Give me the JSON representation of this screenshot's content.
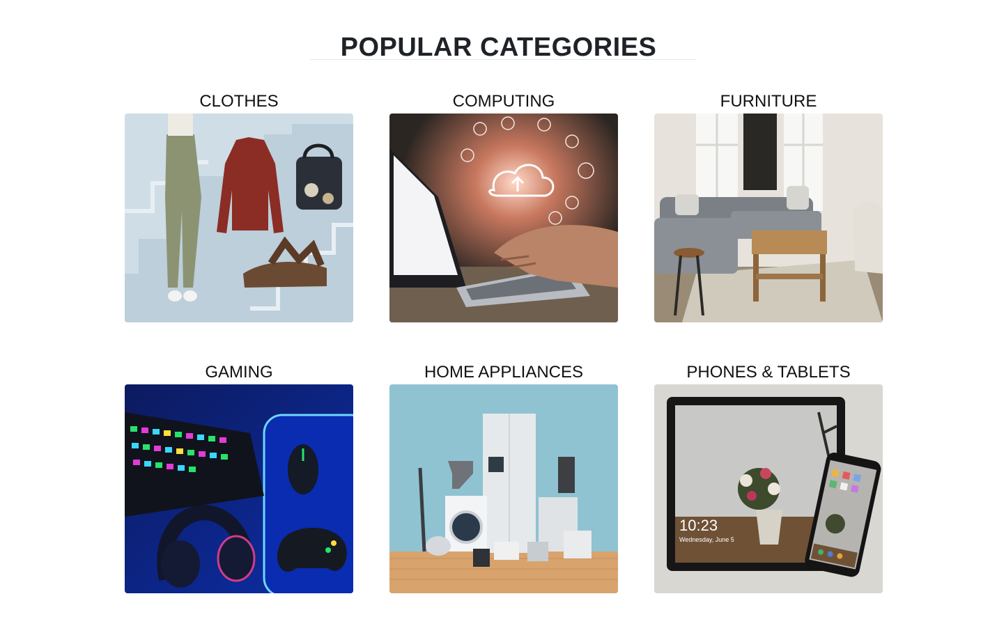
{
  "section": {
    "title": "POPULAR CATEGORIES"
  },
  "categories": [
    {
      "label": "CLOTHES",
      "image": "clothes-image"
    },
    {
      "label": "COMPUTING",
      "image": "computing-image"
    },
    {
      "label": "FURNITURE",
      "image": "furniture-image"
    },
    {
      "label": "GAMING",
      "image": "gaming-image"
    },
    {
      "label": "HOME APPLIANCES",
      "image": "home-appliances-image"
    },
    {
      "label": "PHONES & TABLETS",
      "image": "phones-tablets-image"
    }
  ],
  "phone_screen": {
    "time": "10:23",
    "date": "Wednesday, June 5"
  },
  "colors": {
    "heading": "#1f2328",
    "label": "#111111",
    "rule": "#e6e6e6"
  }
}
